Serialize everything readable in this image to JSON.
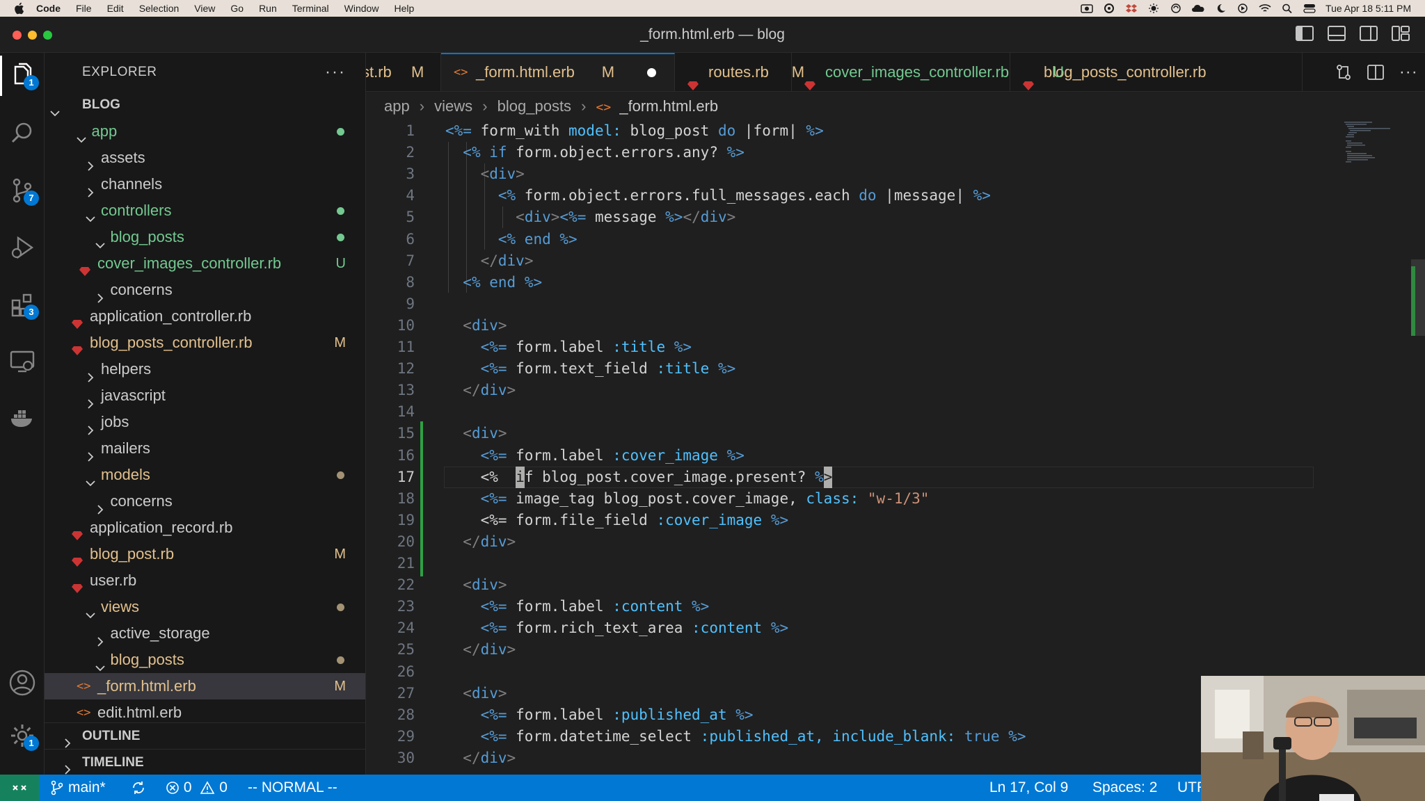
{
  "menubar": {
    "app": "Code",
    "items": [
      "File",
      "Edit",
      "Selection",
      "View",
      "Go",
      "Run",
      "Terminal",
      "Window",
      "Help"
    ],
    "clock": "Tue Apr 18  5:11 PM"
  },
  "window": {
    "title": "_form.html.erb — blog"
  },
  "activity": {
    "explorer_badge": "1",
    "scm_badge": "7",
    "extensions_badge": "3",
    "settings_badge": "1"
  },
  "sidebar": {
    "header": "EXPLORER",
    "more": "···",
    "tree": [
      {
        "label": "BLOG",
        "level": 0,
        "type": "root",
        "expanded": true,
        "color": "#cccccc"
      },
      {
        "label": "app",
        "level": 1,
        "type": "folder",
        "expanded": true,
        "color": "#73c991",
        "dot": "#73c991"
      },
      {
        "label": "assets",
        "level": 2,
        "type": "folder",
        "expanded": false,
        "color": "#cccccc"
      },
      {
        "label": "channels",
        "level": 2,
        "type": "folder",
        "expanded": false,
        "color": "#cccccc"
      },
      {
        "label": "controllers",
        "level": 2,
        "type": "folder",
        "expanded": true,
        "color": "#73c991",
        "dot": "#73c991"
      },
      {
        "label": "blog_posts",
        "level": 3,
        "type": "folder",
        "expanded": true,
        "color": "#73c991",
        "dot": "#73c991"
      },
      {
        "label": "cover_images_controller.rb",
        "level": 4,
        "type": "ruby",
        "color": "#73c991",
        "status": "U",
        "status_color": "#73c991"
      },
      {
        "label": "concerns",
        "level": 3,
        "type": "folder",
        "expanded": false,
        "color": "#cccccc"
      },
      {
        "label": "application_controller.rb",
        "level": 3,
        "type": "ruby",
        "color": "#cccccc"
      },
      {
        "label": "blog_posts_controller.rb",
        "level": 3,
        "type": "ruby",
        "color": "#e2c08d",
        "status": "M",
        "status_color": "#e2c08d"
      },
      {
        "label": "helpers",
        "level": 2,
        "type": "folder",
        "expanded": false,
        "color": "#cccccc"
      },
      {
        "label": "javascript",
        "level": 2,
        "type": "folder",
        "expanded": false,
        "color": "#cccccc"
      },
      {
        "label": "jobs",
        "level": 2,
        "type": "folder",
        "expanded": false,
        "color": "#cccccc"
      },
      {
        "label": "mailers",
        "level": 2,
        "type": "folder",
        "expanded": false,
        "color": "#cccccc"
      },
      {
        "label": "models",
        "level": 2,
        "type": "folder",
        "expanded": true,
        "color": "#e2c08d",
        "dot": "#a39274"
      },
      {
        "label": "concerns",
        "level": 3,
        "type": "folder",
        "expanded": false,
        "color": "#cccccc"
      },
      {
        "label": "application_record.rb",
        "level": 3,
        "type": "ruby",
        "color": "#cccccc"
      },
      {
        "label": "blog_post.rb",
        "level": 3,
        "type": "ruby",
        "color": "#e2c08d",
        "status": "M",
        "status_color": "#e2c08d"
      },
      {
        "label": "user.rb",
        "level": 3,
        "type": "ruby",
        "color": "#cccccc"
      },
      {
        "label": "views",
        "level": 2,
        "type": "folder",
        "expanded": true,
        "color": "#e2c08d",
        "dot": "#a39274"
      },
      {
        "label": "active_storage",
        "level": 3,
        "type": "folder",
        "expanded": false,
        "color": "#cccccc"
      },
      {
        "label": "blog_posts",
        "level": 3,
        "type": "folder",
        "expanded": true,
        "color": "#e2c08d",
        "dot": "#a39274"
      },
      {
        "label": "_form.html.erb",
        "level": 4,
        "type": "erb",
        "color": "#e2c08d",
        "status": "M",
        "status_color": "#e2c08d",
        "selected": true
      },
      {
        "label": "edit.html.erb",
        "level": 4,
        "type": "erb",
        "color": "#cccccc"
      }
    ],
    "outline": "OUTLINE",
    "timeline": "TIMELINE"
  },
  "tabs": [
    {
      "label": "st.rb",
      "status": "M",
      "type": "ruby",
      "active": false
    },
    {
      "label": "_form.html.erb",
      "status": "M",
      "type": "erb",
      "active": true,
      "dirty": true
    },
    {
      "label": "routes.rb",
      "status": "M",
      "type": "ruby",
      "active": false
    },
    {
      "label": "cover_images_controller.rb",
      "status": "U",
      "type": "ruby",
      "active": false
    },
    {
      "label": "blog_posts_controller.rb",
      "status": "",
      "type": "ruby",
      "active": false
    }
  ],
  "breadcrumb": [
    "app",
    "views",
    "blog_posts",
    "_form.html.erb"
  ],
  "editor": {
    "current_line": 17,
    "lines": [
      [
        [
          "t-erb",
          "<%= "
        ],
        [
          "t-w",
          "form_with "
        ],
        [
          "t-sym",
          "model: "
        ],
        [
          "t-w",
          "blog_post "
        ],
        [
          "t-kw",
          "do "
        ],
        [
          "t-w",
          "|form| "
        ],
        [
          "t-erb",
          "%>"
        ]
      ],
      [
        [
          "t-w",
          "  "
        ],
        [
          "t-erb",
          "<% "
        ],
        [
          "t-kw",
          "if "
        ],
        [
          "t-w",
          "form.object.errors.any? "
        ],
        [
          "t-erb",
          "%>"
        ]
      ],
      [
        [
          "t-w",
          "    "
        ],
        [
          "t-tag",
          "<"
        ],
        [
          "t-html",
          "div"
        ],
        [
          "t-tag",
          ">"
        ]
      ],
      [
        [
          "t-w",
          "      "
        ],
        [
          "t-erb",
          "<% "
        ],
        [
          "t-w",
          "form.object.errors.full_messages.each "
        ],
        [
          "t-kw",
          "do "
        ],
        [
          "t-w",
          "|message| "
        ],
        [
          "t-erb",
          "%>"
        ]
      ],
      [
        [
          "t-w",
          "        "
        ],
        [
          "t-tag",
          "<"
        ],
        [
          "t-html",
          "div"
        ],
        [
          "t-tag",
          ">"
        ],
        [
          "t-erb",
          "<%= "
        ],
        [
          "t-w",
          "message "
        ],
        [
          "t-erb",
          "%>"
        ],
        [
          "t-tag",
          "</"
        ],
        [
          "t-html",
          "div"
        ],
        [
          "t-tag",
          ">"
        ]
      ],
      [
        [
          "t-w",
          "      "
        ],
        [
          "t-erb",
          "<% "
        ],
        [
          "t-kw",
          "end "
        ],
        [
          "t-erb",
          "%>"
        ]
      ],
      [
        [
          "t-w",
          "    "
        ],
        [
          "t-tag",
          "</"
        ],
        [
          "t-html",
          "div"
        ],
        [
          "t-tag",
          ">"
        ]
      ],
      [
        [
          "t-w",
          "  "
        ],
        [
          "t-erb",
          "<% "
        ],
        [
          "t-kw",
          "end "
        ],
        [
          "t-erb",
          "%>"
        ]
      ],
      [],
      [
        [
          "t-w",
          "  "
        ],
        [
          "t-tag",
          "<"
        ],
        [
          "t-html",
          "div"
        ],
        [
          "t-tag",
          ">"
        ]
      ],
      [
        [
          "t-w",
          "    "
        ],
        [
          "t-erb",
          "<%= "
        ],
        [
          "t-w",
          "form.label "
        ],
        [
          "t-sym",
          ":title "
        ],
        [
          "t-erb",
          "%>"
        ]
      ],
      [
        [
          "t-w",
          "    "
        ],
        [
          "t-erb",
          "<%= "
        ],
        [
          "t-w",
          "form.text_field "
        ],
        [
          "t-sym",
          ":title "
        ],
        [
          "t-erb",
          "%>"
        ]
      ],
      [
        [
          "t-w",
          "  "
        ],
        [
          "t-tag",
          "</"
        ],
        [
          "t-html",
          "div"
        ],
        [
          "t-tag",
          ">"
        ]
      ],
      [],
      [
        [
          "t-w",
          "  "
        ],
        [
          "t-tag",
          "<"
        ],
        [
          "t-html",
          "div"
        ],
        [
          "t-tag",
          ">"
        ]
      ],
      [
        [
          "t-w",
          "    "
        ],
        [
          "t-erb",
          "<%= "
        ],
        [
          "t-w",
          "form.label "
        ],
        [
          "t-sym",
          ":cover_image "
        ],
        [
          "t-erb",
          "%>"
        ]
      ],
      [
        [
          "t-w",
          "    "
        ],
        [
          "t-w",
          "<%  "
        ],
        [
          "cursor",
          "i"
        ],
        [
          "t-w",
          "f blog_post.cover_image.present? "
        ],
        [
          "t-erb",
          "%"
        ],
        [
          "cursor",
          ">"
        ]
      ],
      [
        [
          "t-w",
          "    "
        ],
        [
          "t-erb",
          "<%= "
        ],
        [
          "t-w",
          "image_tag blog_post.cover_image, "
        ],
        [
          "t-sym",
          "class: "
        ],
        [
          "t-str",
          "\"w-1/3\""
        ]
      ],
      [
        [
          "t-w",
          "    "
        ],
        [
          "t-w",
          "<%= "
        ],
        [
          "t-w",
          "form.file_field "
        ],
        [
          "t-sym",
          ":cover_image "
        ],
        [
          "t-erb",
          "%>"
        ]
      ],
      [
        [
          "t-w",
          "  "
        ],
        [
          "t-tag",
          "</"
        ],
        [
          "t-html",
          "div"
        ],
        [
          "t-tag",
          ">"
        ]
      ],
      [],
      [
        [
          "t-w",
          "  "
        ],
        [
          "t-tag",
          "<"
        ],
        [
          "t-html",
          "div"
        ],
        [
          "t-tag",
          ">"
        ]
      ],
      [
        [
          "t-w",
          "    "
        ],
        [
          "t-erb",
          "<%= "
        ],
        [
          "t-w",
          "form.label "
        ],
        [
          "t-sym",
          ":content "
        ],
        [
          "t-erb",
          "%>"
        ]
      ],
      [
        [
          "t-w",
          "    "
        ],
        [
          "t-erb",
          "<%= "
        ],
        [
          "t-w",
          "form.rich_text_area "
        ],
        [
          "t-sym",
          ":content "
        ],
        [
          "t-erb",
          "%>"
        ]
      ],
      [
        [
          "t-w",
          "  "
        ],
        [
          "t-tag",
          "</"
        ],
        [
          "t-html",
          "div"
        ],
        [
          "t-tag",
          ">"
        ]
      ],
      [],
      [
        [
          "t-w",
          "  "
        ],
        [
          "t-tag",
          "<"
        ],
        [
          "t-html",
          "div"
        ],
        [
          "t-tag",
          ">"
        ]
      ],
      [
        [
          "t-w",
          "    "
        ],
        [
          "t-erb",
          "<%= "
        ],
        [
          "t-w",
          "form.label "
        ],
        [
          "t-sym",
          ":published_at "
        ],
        [
          "t-erb",
          "%>"
        ]
      ],
      [
        [
          "t-w",
          "    "
        ],
        [
          "t-erb",
          "<%= "
        ],
        [
          "t-w",
          "form.datetime_select "
        ],
        [
          "t-sym",
          ":published_at, include_blank: "
        ],
        [
          "t-kw",
          "true "
        ],
        [
          "t-erb",
          "%>"
        ]
      ],
      [
        [
          "t-w",
          "  "
        ],
        [
          "t-tag",
          "</"
        ],
        [
          "t-html",
          "div"
        ],
        [
          "t-tag",
          ">"
        ]
      ]
    ]
  },
  "status": {
    "branch": "main*",
    "errors": "0",
    "warnings": "0",
    "mode": "-- NORMAL --",
    "position": "Ln 17, Col 9",
    "spaces": "Spaces: 2",
    "encoding": "UTF"
  },
  "colors": {
    "accent": "#0078d4",
    "added": "#73c991",
    "modified": "#e2c08d",
    "ruby": "#cc3434"
  }
}
